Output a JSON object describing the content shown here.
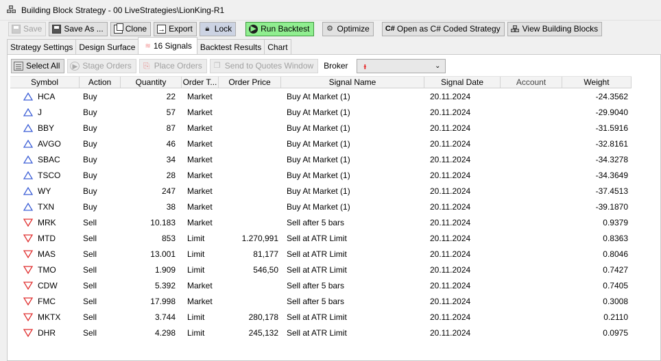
{
  "window": {
    "title": "Building Block Strategy - 00 LiveStrategies\\LionKing-R1",
    "icon": "blocks-icon"
  },
  "toolbar": {
    "save": "Save",
    "save_as": "Save As ...",
    "clone": "Clone",
    "export": "Export",
    "lock": "Lock",
    "run_backtest": "Run Backtest",
    "optimize": "Optimize",
    "open_cs": "Open as C# Coded Strategy",
    "view_blocks": "View Building Blocks",
    "cs_icon_text": "C#"
  },
  "tabs": {
    "strategy_settings": "Strategy Settings",
    "design_surface": "Design Surface",
    "signals": "16 Signals",
    "backtest_results": "Backtest Results",
    "chart": "Chart"
  },
  "signals_toolbar": {
    "select_all": "Select All",
    "stage_orders": "Stage Orders",
    "place_orders": "Place Orders",
    "send_to_quotes": "Send to Quotes Window",
    "broker_label": "Broker"
  },
  "columns": [
    "Symbol",
    "Action",
    "Quantity",
    "Order T...",
    "Order Price",
    "Signal Name",
    "Signal Date",
    "Account",
    "Weight"
  ],
  "colors": {
    "buy_icon": "#3d5fd6",
    "sell_icon": "#e03030",
    "run_button": "#90ee90"
  },
  "rows": [
    {
      "symbol": "HCA",
      "action": "Buy",
      "quantity": "22",
      "order_type": "Market",
      "order_price": "",
      "signal_name": "Buy At Market (1)",
      "signal_date": "20.11.2024",
      "account": "",
      "weight": "-24.3562"
    },
    {
      "symbol": "J",
      "action": "Buy",
      "quantity": "57",
      "order_type": "Market",
      "order_price": "",
      "signal_name": "Buy At Market (1)",
      "signal_date": "20.11.2024",
      "account": "",
      "weight": "-29.9040"
    },
    {
      "symbol": "BBY",
      "action": "Buy",
      "quantity": "87",
      "order_type": "Market",
      "order_price": "",
      "signal_name": "Buy At Market (1)",
      "signal_date": "20.11.2024",
      "account": "",
      "weight": "-31.5916"
    },
    {
      "symbol": "AVGO",
      "action": "Buy",
      "quantity": "46",
      "order_type": "Market",
      "order_price": "",
      "signal_name": "Buy At Market (1)",
      "signal_date": "20.11.2024",
      "account": "",
      "weight": "-32.8161"
    },
    {
      "symbol": "SBAC",
      "action": "Buy",
      "quantity": "34",
      "order_type": "Market",
      "order_price": "",
      "signal_name": "Buy At Market (1)",
      "signal_date": "20.11.2024",
      "account": "",
      "weight": "-34.3278"
    },
    {
      "symbol": "TSCO",
      "action": "Buy",
      "quantity": "28",
      "order_type": "Market",
      "order_price": "",
      "signal_name": "Buy At Market (1)",
      "signal_date": "20.11.2024",
      "account": "",
      "weight": "-34.3649"
    },
    {
      "symbol": "WY",
      "action": "Buy",
      "quantity": "247",
      "order_type": "Market",
      "order_price": "",
      "signal_name": "Buy At Market (1)",
      "signal_date": "20.11.2024",
      "account": "",
      "weight": "-37.4513"
    },
    {
      "symbol": "TXN",
      "action": "Buy",
      "quantity": "38",
      "order_type": "Market",
      "order_price": "",
      "signal_name": "Buy At Market (1)",
      "signal_date": "20.11.2024",
      "account": "",
      "weight": "-39.1870"
    },
    {
      "symbol": "MRK",
      "action": "Sell",
      "quantity": "10.183",
      "order_type": "Market",
      "order_price": "",
      "signal_name": "Sell after 5 bars",
      "signal_date": "20.11.2024",
      "account": "",
      "weight": "0.9379"
    },
    {
      "symbol": "MTD",
      "action": "Sell",
      "quantity": "853",
      "order_type": "Limit",
      "order_price": "1.270,991",
      "signal_name": "Sell at ATR Limit",
      "signal_date": "20.11.2024",
      "account": "",
      "weight": "0.8363"
    },
    {
      "symbol": "MAS",
      "action": "Sell",
      "quantity": "13.001",
      "order_type": "Limit",
      "order_price": "81,177",
      "signal_name": "Sell at ATR Limit",
      "signal_date": "20.11.2024",
      "account": "",
      "weight": "0.8046"
    },
    {
      "symbol": "TMO",
      "action": "Sell",
      "quantity": "1.909",
      "order_type": "Limit",
      "order_price": "546,50",
      "signal_name": "Sell at ATR Limit",
      "signal_date": "20.11.2024",
      "account": "",
      "weight": "0.7427"
    },
    {
      "symbol": "CDW",
      "action": "Sell",
      "quantity": "5.392",
      "order_type": "Market",
      "order_price": "",
      "signal_name": "Sell after 5 bars",
      "signal_date": "20.11.2024",
      "account": "",
      "weight": "0.7405"
    },
    {
      "symbol": "FMC",
      "action": "Sell",
      "quantity": "17.998",
      "order_type": "Market",
      "order_price": "",
      "signal_name": "Sell after 5 bars",
      "signal_date": "20.11.2024",
      "account": "",
      "weight": "0.3008"
    },
    {
      "symbol": "MKTX",
      "action": "Sell",
      "quantity": "3.744",
      "order_type": "Limit",
      "order_price": "280,178",
      "signal_name": "Sell at ATR Limit",
      "signal_date": "20.11.2024",
      "account": "",
      "weight": "0.2110"
    },
    {
      "symbol": "DHR",
      "action": "Sell",
      "quantity": "4.298",
      "order_type": "Limit",
      "order_price": "245,132",
      "signal_name": "Sell at ATR Limit",
      "signal_date": "20.11.2024",
      "account": "",
      "weight": "0.0975"
    }
  ]
}
